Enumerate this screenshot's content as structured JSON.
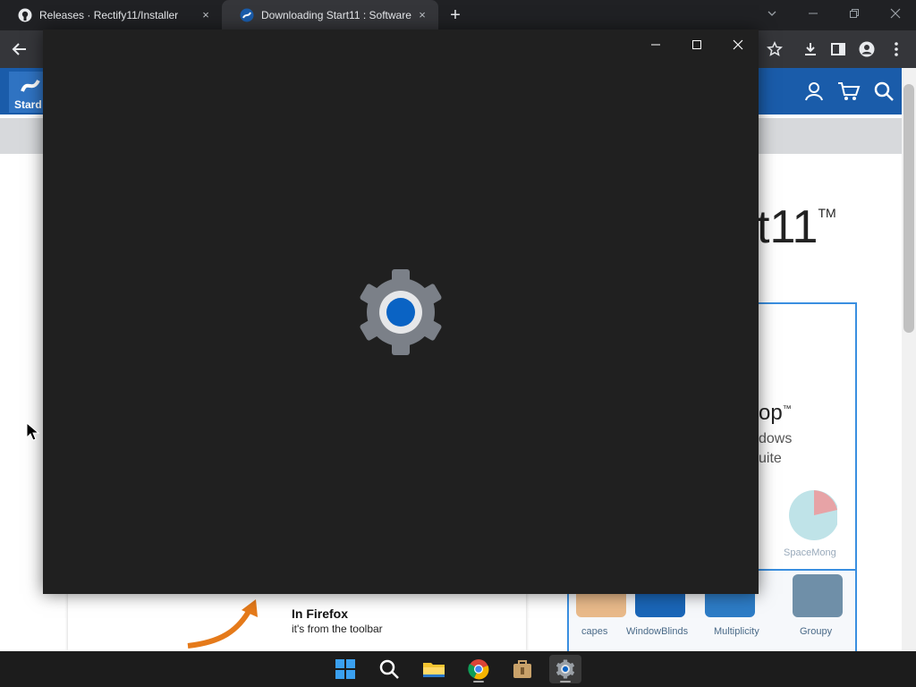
{
  "browser": {
    "tabs": [
      {
        "title": "Releases · Rectify11/Installer",
        "icon": "github-icon",
        "active": false
      },
      {
        "title": "Downloading Start11 : Software",
        "icon": "stardock-icon",
        "active": true
      }
    ],
    "close_glyph": "×",
    "new_tab_glyph": "+"
  },
  "page": {
    "logo_text": "Stard",
    "product_title": "t11",
    "trademark": "TM",
    "promo_line1": "op",
    "promo_line2": "dows",
    "promo_line3": "uite",
    "spacemonger": "SpaceMong",
    "products": [
      "capes",
      "WindowBlinds",
      "Multiplicity",
      "Groupy"
    ],
    "firefox_title": "In Firefox",
    "firefox_sub": "it's from the toolbar"
  },
  "overlay_window": {
    "content_icon": "settings-gear-icon"
  },
  "taskbar": {
    "apps": [
      "windows-start-icon",
      "search-icon",
      "file-explorer-icon",
      "chrome-icon",
      "store-package-icon",
      "settings-icon"
    ],
    "active_app": "settings-icon"
  },
  "colors": {
    "tabstrip_bg": "#202124",
    "toolbar_bg": "#35363a",
    "site_header": "#1a5caa",
    "window_bg": "#202020",
    "accent_blue": "#0a63c4"
  }
}
